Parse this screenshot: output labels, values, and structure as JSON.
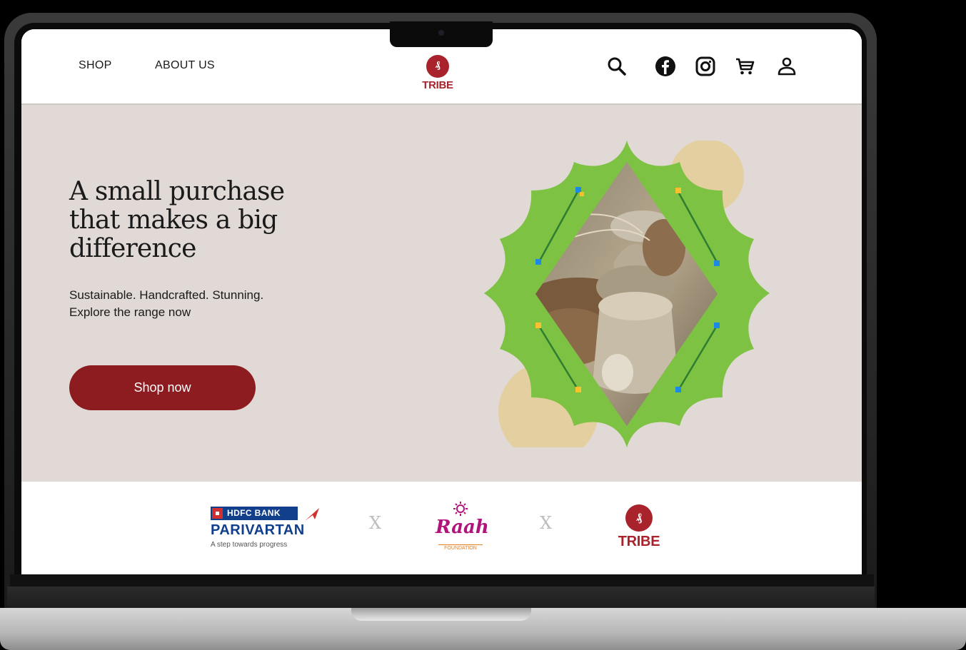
{
  "header": {
    "nav": [
      {
        "label": "SHOP"
      },
      {
        "label": "ABOUT US"
      }
    ],
    "logo": {
      "text": "TRIBE"
    },
    "icons": [
      "search-icon",
      "facebook-icon",
      "instagram-icon",
      "cart-icon",
      "user-icon"
    ]
  },
  "hero": {
    "headline": "A small purchase that makes a big difference",
    "subline1": "Sustainable. Handcrafted. Stunning.",
    "subline2": "Explore the range now",
    "cta_label": "Shop now"
  },
  "partners": {
    "hdfc_badge": "HDFC BANK",
    "hdfc_name": "PARIVARTAN",
    "hdfc_tagline": "A step towards progress",
    "separator": "X",
    "raah_name": "Raah",
    "raah_sub": "FOUNDATION",
    "tribe_name": "TRIBE"
  },
  "colors": {
    "brand_red": "#8c1c20",
    "hero_bg": "#e0d9d5",
    "lotus_green": "#7dc242",
    "accent_sand": "#e4cfa0"
  }
}
